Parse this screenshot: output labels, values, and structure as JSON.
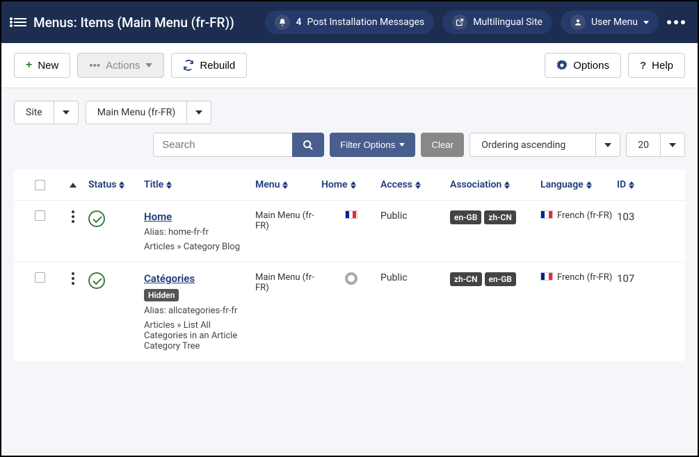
{
  "header": {
    "title": "Menus: Items (Main Menu (fr-FR))",
    "notif_count": "4",
    "notif_label": "Post Installation Messages",
    "site_label": "Multilingual Site",
    "user_menu": "User Menu"
  },
  "toolbar": {
    "new": "New",
    "actions": "Actions",
    "rebuild": "Rebuild",
    "options": "Options",
    "help": "Help"
  },
  "filters": {
    "client": "Site",
    "menu": "Main Menu (fr-FR)",
    "search_placeholder": "Search",
    "filter_options": "Filter Options",
    "clear": "Clear",
    "ordering": "Ordering ascending",
    "limit": "20"
  },
  "columns": {
    "status": "Status",
    "title": "Title",
    "menu": "Menu",
    "home": "Home",
    "access": "Access",
    "association": "Association",
    "language": "Language",
    "id": "ID"
  },
  "rows": [
    {
      "title": "Home",
      "hidden": false,
      "alias": "Alias: home-fr-fr",
      "path": "Articles » Category Blog",
      "menu": "Main Menu (fr-FR)",
      "home_flag": true,
      "access": "Public",
      "assoc": [
        "en-GB",
        "zh-CN"
      ],
      "language": "French (fr-FR)",
      "id": "103"
    },
    {
      "title": "Catégories",
      "hidden": true,
      "hidden_label": "Hidden",
      "alias": "Alias: allcategories-fr-fr",
      "path": "Articles » List All Categories in an Article Category Tree",
      "menu": "Main Menu (fr-FR)",
      "home_flag": false,
      "access": "Public",
      "assoc": [
        "zh-CN",
        "en-GB"
      ],
      "language": "French (fr-FR)",
      "id": "107"
    }
  ]
}
